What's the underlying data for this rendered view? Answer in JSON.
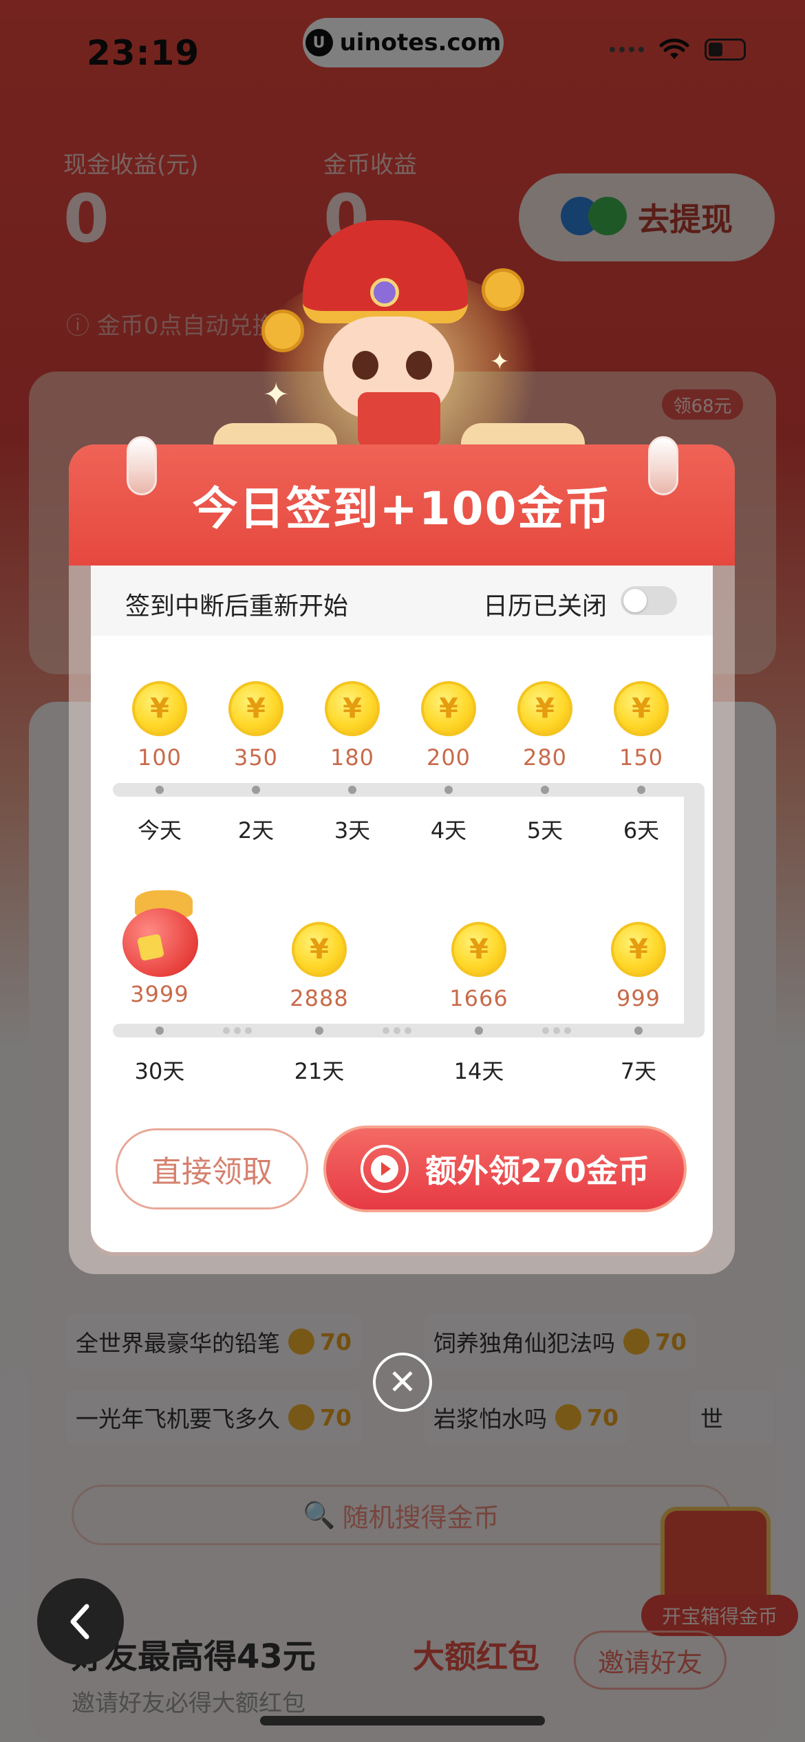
{
  "status_bar": {
    "time": "23:19",
    "watermark": "uinotes.com"
  },
  "earnings": {
    "cash_label": "现金收益(元)",
    "cash_value": "0",
    "coin_label": "金币收益",
    "coin_value": "0",
    "withdraw_label": "去提现",
    "auto_note": "金币0点自动兑换"
  },
  "promo_badge": "领68元",
  "modal": {
    "title": "今日签到+100金币",
    "subtitle": "签到中断后重新开始",
    "calendar_label": "日历已关闭",
    "calendar_enabled": false,
    "row1": [
      {
        "amount": "100",
        "day": "今天"
      },
      {
        "amount": "350",
        "day": "2天"
      },
      {
        "amount": "180",
        "day": "3天"
      },
      {
        "amount": "200",
        "day": "4天"
      },
      {
        "amount": "280",
        "day": "5天"
      },
      {
        "amount": "150",
        "day": "6天"
      }
    ],
    "row2": [
      {
        "amount": "3999",
        "day": "30天",
        "type": "bag"
      },
      {
        "amount": "2888",
        "day": "21天",
        "type": "coin"
      },
      {
        "amount": "1666",
        "day": "14天",
        "type": "coin"
      },
      {
        "amount": "999",
        "day": "7天",
        "type": "coin"
      }
    ],
    "coin_symbol": "¥",
    "direct_button": "直接领取",
    "extra_button": "额外领270金币",
    "close_symbol": "✕"
  },
  "tasks": [
    {
      "label": "全世界最豪华的铅笔",
      "reward": "70"
    },
    {
      "label": "饲养独角仙犯法吗",
      "reward": "70"
    },
    {
      "label": "一光年飞机要飞多久",
      "reward": "70"
    },
    {
      "label": "岩浆怕水吗",
      "reward": "70"
    },
    {
      "label": "世",
      "reward": ""
    }
  ],
  "search_button": "随机搜得金币",
  "treasure_label": "开宝箱得金币",
  "invite": {
    "title": "好友最高得43元",
    "tag": "大额红包",
    "subtitle": "邀请好友必得大额红包",
    "button": "邀请好友"
  },
  "colors": {
    "accent": "#e6483f",
    "coin": "#ffd82a",
    "amount": "#c86a4a"
  }
}
